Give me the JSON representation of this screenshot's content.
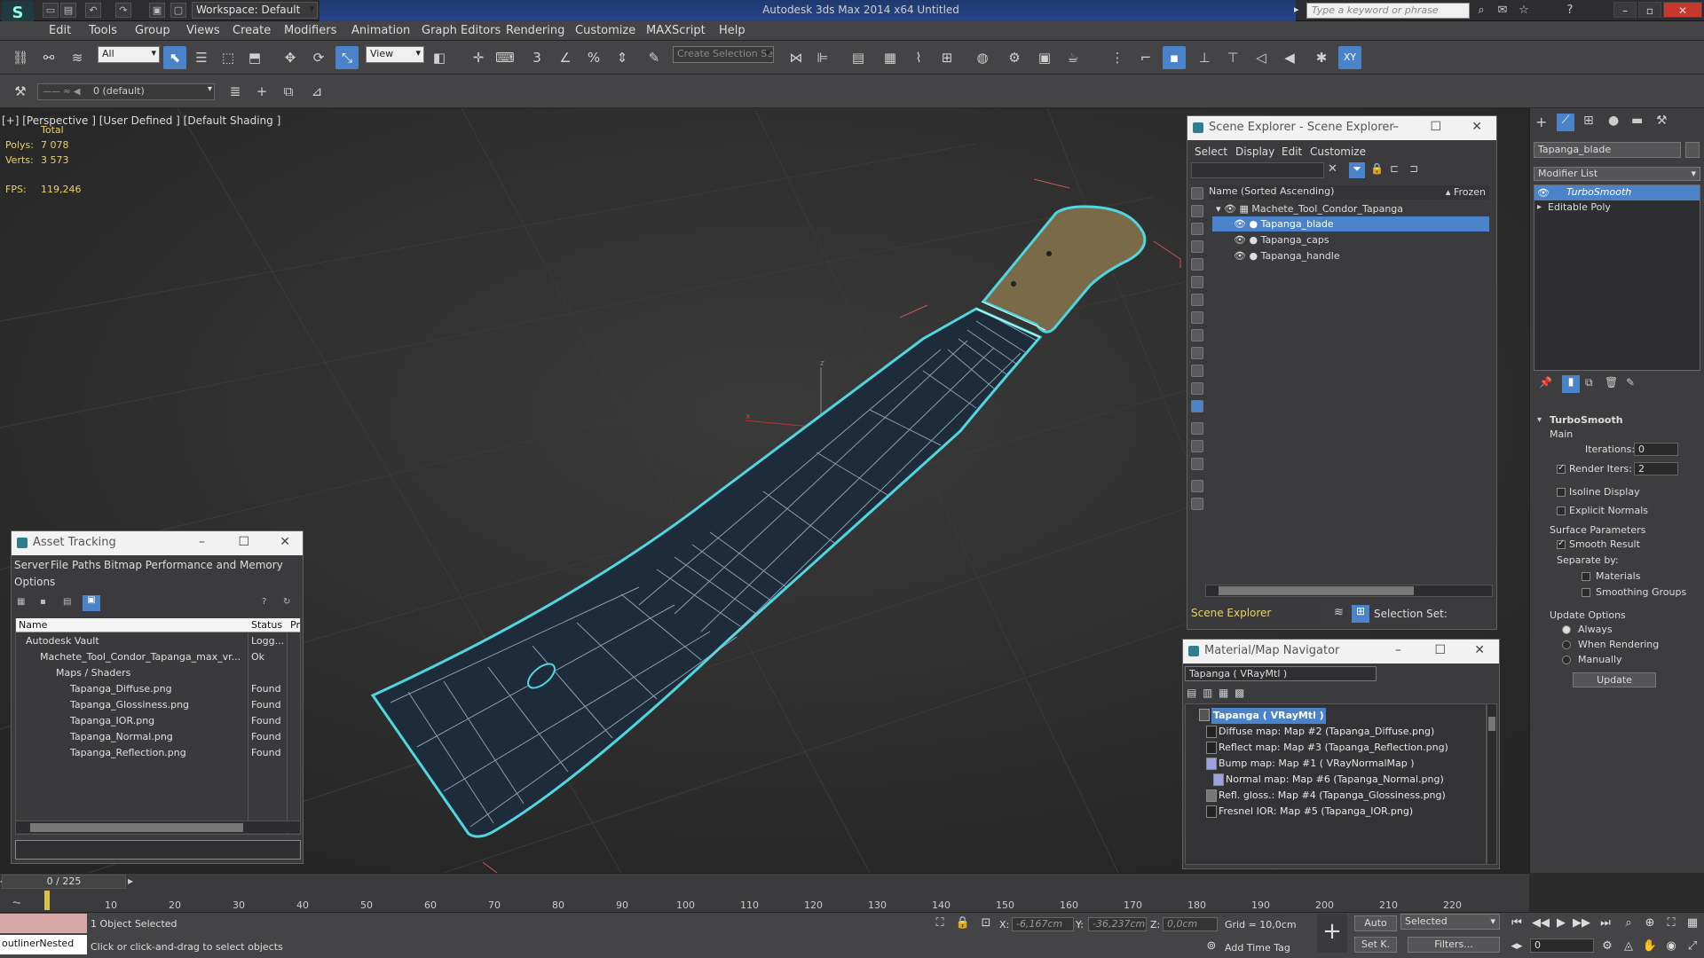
{
  "titlebar": {
    "workspace": "Workspace: Default",
    "title": "Autodesk 3ds Max  2014 x64      Untitled",
    "search_placeholder": "Type a keyword or phrase"
  },
  "menu": [
    "Edit",
    "Tools",
    "Group",
    "Views",
    "Create",
    "Modifiers",
    "Animation",
    "Graph Editors",
    "Rendering",
    "Customize",
    "MAXScript",
    "Help"
  ],
  "toolbar": {
    "selection_filter": "All",
    "ref_coord": "View",
    "named_selection": "Create Selection Se",
    "layer": "0 (default)"
  },
  "viewport": {
    "label": "[+] [Perspective ]  [User Defined ]  [Default Shading ]",
    "total_label": "Total",
    "polys_label": "Polys:",
    "polys_value": "7 078",
    "verts_label": "Verts:",
    "verts_value": "3 573",
    "fps_label": "FPS:",
    "fps_value": "119,246"
  },
  "scene_explorer": {
    "title": "Scene Explorer - Scene Explorer",
    "menu": [
      "Select",
      "Display",
      "Edit",
      "Customize"
    ],
    "col_name": "Name (Sorted Ascending)",
    "col_frozen": "▴ Frozen",
    "rows": [
      {
        "label": "Machete_Tool_Condor_Tapanga",
        "indent": 0,
        "selected": false
      },
      {
        "label": "Tapanga_blade",
        "indent": 1,
        "selected": true
      },
      {
        "label": "Tapanga_caps",
        "indent": 1,
        "selected": false
      },
      {
        "label": "Tapanga_handle",
        "indent": 1,
        "selected": false
      }
    ],
    "footer_name": "Scene Explorer",
    "footer_selset": "Selection Set:"
  },
  "asset_tracking": {
    "title": "Asset Tracking",
    "menu1": [
      "Server",
      "File",
      "Paths",
      "Bitmap Performance and Memory"
    ],
    "menu2": "Options",
    "col_name": "Name",
    "col_status": "Status",
    "col_pr": "Pr",
    "rows": [
      {
        "name": "Autodesk Vault",
        "status": "Logg...",
        "indent": 0
      },
      {
        "name": "Machete_Tool_Condor_Tapanga_max_vr...",
        "status": "Ok",
        "indent": 1
      },
      {
        "name": "Maps / Shaders",
        "status": "",
        "indent": 2
      },
      {
        "name": "Tapanga_Diffuse.png",
        "status": "Found",
        "indent": 3
      },
      {
        "name": "Tapanga_Glossiness.png",
        "status": "Found",
        "indent": 3
      },
      {
        "name": "Tapanga_IOR.png",
        "status": "Found",
        "indent": 3
      },
      {
        "name": "Tapanga_Normal.png",
        "status": "Found",
        "indent": 3
      },
      {
        "name": "Tapanga_Reflection.png",
        "status": "Found",
        "indent": 3
      }
    ]
  },
  "material_navigator": {
    "title": "Material/Map Navigator",
    "current": "Tapanga  ( VRayMtl )",
    "root": "Tapanga  ( VRayMtl )",
    "rows": [
      "Diffuse map: Map #2 (Tapanga_Diffuse.png)",
      "Reflect map: Map #3 (Tapanga_Reflection.png)",
      "Bump map: Map #1  ( VRayNormalMap )",
      "Normal map: Map #6 (Tapanga_Normal.png)",
      "Refl. gloss.: Map #4 (Tapanga_Glossiness.png)",
      "Fresnel IOR: Map #5 (Tapanga_IOR.png)"
    ]
  },
  "command_panel": {
    "object_name": "Tapanga_blade",
    "modifier_list": "Modifier List",
    "stack": [
      "TurboSmooth",
      "Editable Poly"
    ],
    "rollout_title": "TurboSmooth",
    "main_label": "Main",
    "iterations_label": "Iterations:",
    "iterations_value": "0",
    "render_iters_label": "Render Iters:",
    "render_iters_value": "2",
    "isoline": "Isoline Display",
    "explicit_normals": "Explicit Normals",
    "surface_params": "Surface Parameters",
    "smooth_result": "Smooth Result",
    "separate_by": "Separate by:",
    "materials": "Materials",
    "smoothing_groups": "Smoothing Groups",
    "update_options": "Update Options",
    "always": "Always",
    "when_rendering": "When Rendering",
    "manually": "Manually",
    "update_btn": "Update"
  },
  "timeline": {
    "frame": "0 / 225",
    "ticks": [
      "10",
      "20",
      "30",
      "40",
      "50",
      "60",
      "70",
      "80",
      "90",
      "100",
      "110",
      "120",
      "130",
      "140",
      "150",
      "160",
      "170",
      "180",
      "190",
      "200",
      "210",
      "220"
    ]
  },
  "status": {
    "script_field": "outlinerNested",
    "selected": "1 Object Selected",
    "prompt": "Click or click-and-drag to select objects",
    "x_label": "X:",
    "x_value": "-6,167cm",
    "y_label": "Y:",
    "y_value": "-36,237cm",
    "z_label": "Z:",
    "z_value": "0,0cm",
    "grid": "Grid = 10,0cm",
    "add_time_tag": "Add Time Tag",
    "auto": "Auto",
    "selected_dd": "Selected",
    "setk": "Set K.",
    "filters": "Filters...",
    "frame_value": "0"
  }
}
